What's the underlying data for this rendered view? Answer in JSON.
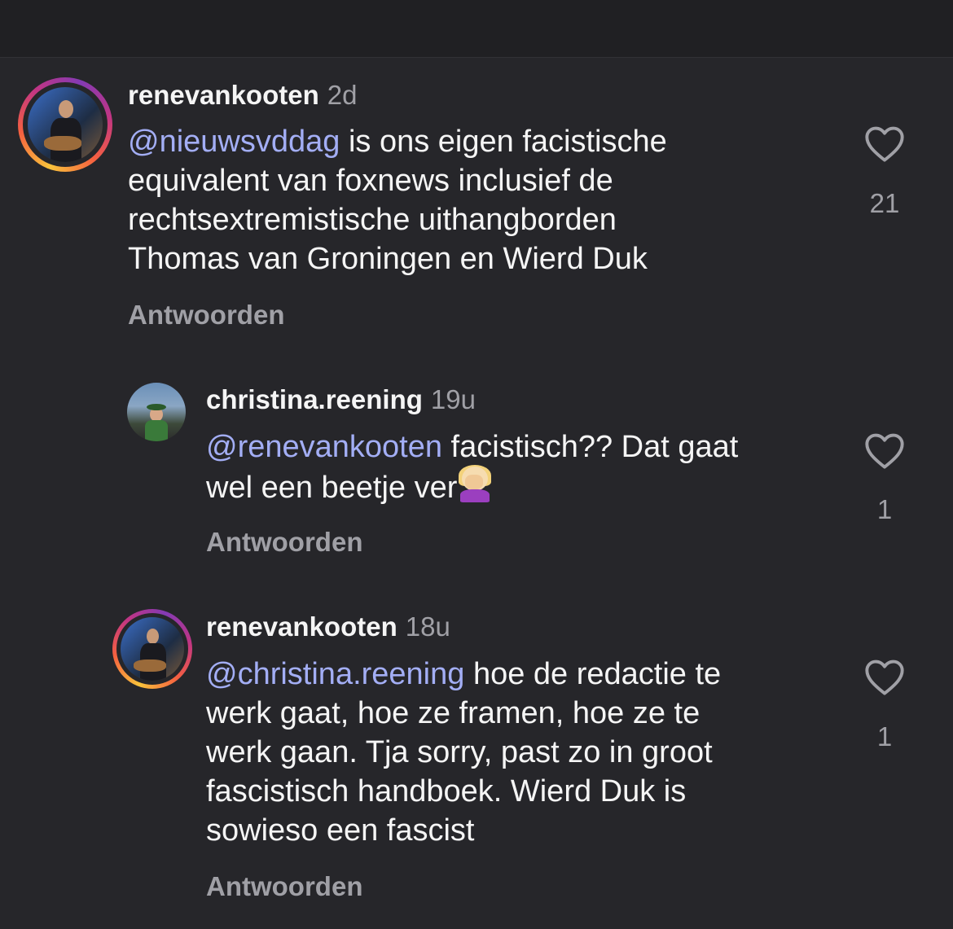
{
  "comments": [
    {
      "username": "renevankooten",
      "time": "2d",
      "mention": "@nieuwsvddag",
      "lines": [
        " is ons eigen facistische",
        "equivalent van foxnews inclusief de",
        "rechtsextremistische uithangborden",
        "Thomas van Groningen en Wierd Duk"
      ],
      "reply_label": "Antwoorden",
      "likes": "21",
      "avatar_ring": true
    },
    {
      "username": "christina.reening",
      "time": "19u",
      "mention": "@renevankooten",
      "lines": [
        " facistisch?? Dat gaat",
        "wel een beetje ver"
      ],
      "emoji": "face-palm-emoji",
      "reply_label": "Antwoorden",
      "likes": "1",
      "avatar_ring": false
    },
    {
      "username": "renevankooten",
      "time": "18u",
      "mention": "@christina.reening",
      "lines": [
        " hoe de redactie te",
        "werk gaat, hoe ze framen, hoe ze te",
        "werk gaan. Tja sorry, past zo in groot",
        "fascistisch handboek. Wierd Duk is",
        "sowieso een fascist"
      ],
      "reply_label": "Antwoorden",
      "likes": "1",
      "avatar_ring": true
    }
  ],
  "icons": {
    "like": "heart-outline-icon"
  },
  "colors": {
    "background": "#26262a",
    "mention": "#a3aef5",
    "muted": "#a0a0a6"
  }
}
